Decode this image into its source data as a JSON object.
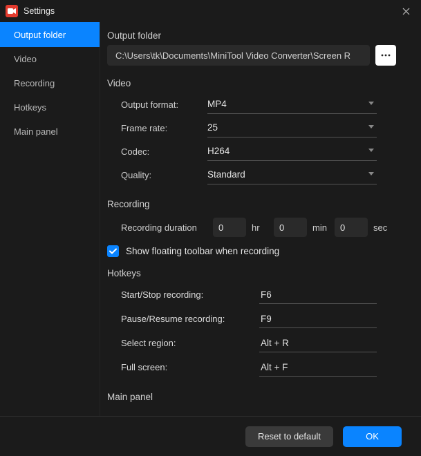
{
  "titlebar": {
    "title": "Settings"
  },
  "sidebar": {
    "items": [
      {
        "label": "Output folder",
        "active": true
      },
      {
        "label": "Video"
      },
      {
        "label": "Recording"
      },
      {
        "label": "Hotkeys"
      },
      {
        "label": "Main panel"
      }
    ]
  },
  "output_folder": {
    "title": "Output folder",
    "path": "C:\\Users\\tk\\Documents\\MiniTool Video Converter\\Screen R"
  },
  "video": {
    "title": "Video",
    "format_label": "Output format:",
    "format_value": "MP4",
    "framerate_label": "Frame rate:",
    "framerate_value": "25",
    "codec_label": "Codec:",
    "codec_value": "H264",
    "quality_label": "Quality:",
    "quality_value": "Standard"
  },
  "recording": {
    "title": "Recording",
    "duration_label": "Recording duration",
    "hr": "0",
    "hr_unit": "hr",
    "min": "0",
    "min_unit": "min",
    "sec": "0",
    "sec_unit": "sec",
    "show_toolbar_label": "Show floating toolbar when recording",
    "show_toolbar_checked": true
  },
  "hotkeys": {
    "title": "Hotkeys",
    "start_label": "Start/Stop recording:",
    "start_value": "F6",
    "pause_label": "Pause/Resume recording:",
    "pause_value": "F9",
    "region_label": "Select region:",
    "region_value": "Alt + R",
    "full_label": "Full screen:",
    "full_value": "Alt + F"
  },
  "main_panel": {
    "title": "Main panel"
  },
  "footer": {
    "reset": "Reset to default",
    "ok": "OK"
  },
  "colors": {
    "accent": "#0a84ff",
    "app_icon": "#e43b2e"
  }
}
